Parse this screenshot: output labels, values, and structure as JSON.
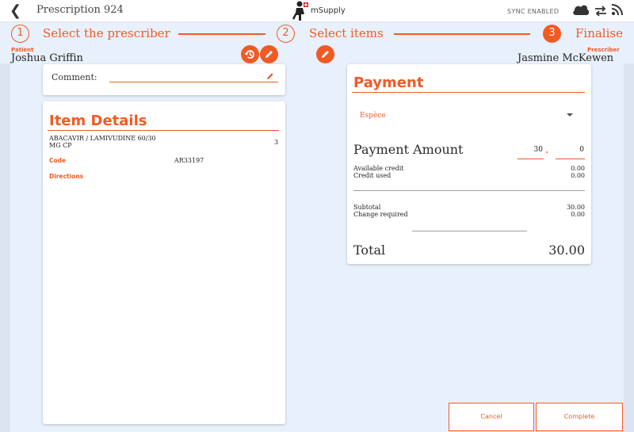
{
  "header": {
    "title": "Prescription 924",
    "logo_text": "mSupply",
    "sync_status": "SYNC ENABLED"
  },
  "stepper": {
    "steps": [
      {
        "number": "1",
        "label": "Select the prescriber"
      },
      {
        "number": "2",
        "label": "Select items"
      },
      {
        "number": "3",
        "label": "Finalise"
      }
    ]
  },
  "patient": {
    "label": "Patient",
    "name": "Joshua Griffin"
  },
  "prescriber": {
    "label": "Prescriber",
    "name": "Jasmine McKewen"
  },
  "comment": {
    "label": "Comment:"
  },
  "item_details": {
    "heading": "Item Details",
    "name_line1": "ABACAVIR / LAMIVUDINE 60/30",
    "name_line2": "MG CP",
    "quantity": "3",
    "code_label": "Code",
    "code_value": "AR33197",
    "directions_label": "Directions"
  },
  "payment": {
    "heading": "Payment",
    "method": "Espèce",
    "amount_label": "Payment Amount",
    "amount_whole": "30",
    "amount_cents": "0",
    "available_credit_label": "Available credit",
    "available_credit_value": "0.00",
    "credit_used_label": "Credit used",
    "credit_used_value": "0.00",
    "subtotal_label": "Subtotal",
    "subtotal_value": "30.00",
    "change_label": "Change required",
    "change_value": "0.00",
    "total_label": "Total",
    "total_value": "30.00"
  },
  "actions": {
    "cancel": "Cancel",
    "complete": "Complete"
  },
  "colors": {
    "accent": "#f15a24",
    "background": "#e8f0fb"
  }
}
